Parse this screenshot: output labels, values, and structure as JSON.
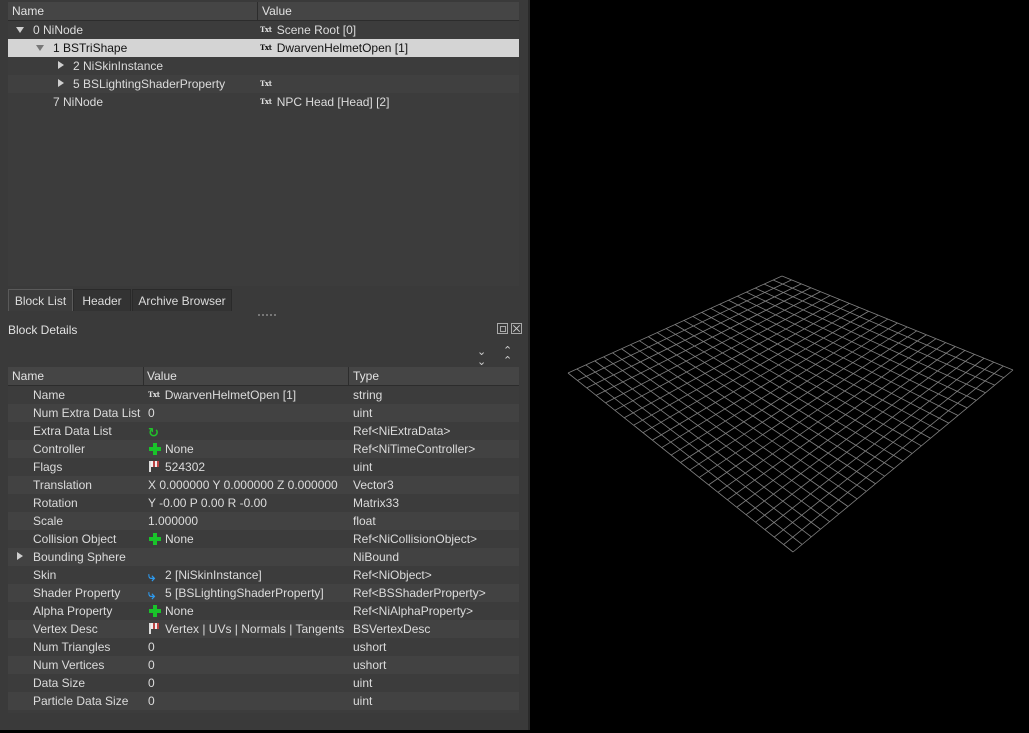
{
  "block_list": {
    "columns": {
      "name": "Name",
      "value": "Value"
    },
    "rows": [
      {
        "name": "0 NiNode",
        "value": "Scene Root [0]"
      },
      {
        "name": "1 BSTriShape",
        "value": "DwarvenHelmetOpen [1]"
      },
      {
        "name": "2 NiSkinInstance",
        "value": ""
      },
      {
        "name": "5 BSLightingShaderProperty",
        "value": ""
      },
      {
        "name": "7 NiNode",
        "value": "NPC Head [Head] [2]"
      }
    ],
    "txt_icon": "Txt"
  },
  "tabs": [
    "Block List",
    "Header",
    "Archive Browser"
  ],
  "block_details": {
    "title": "Block Details",
    "columns": {
      "name": "Name",
      "value": "Value",
      "type": "Type"
    },
    "rows": [
      {
        "name": "Name",
        "value": "DwarvenHelmetOpen [1]",
        "type": "string"
      },
      {
        "name": "Num Extra Data List",
        "value": "0",
        "type": "uint"
      },
      {
        "name": "Extra Data List",
        "value": "",
        "type": "Ref<NiExtraData>"
      },
      {
        "name": "Controller",
        "value": "None",
        "type": "Ref<NiTimeController>"
      },
      {
        "name": "Flags",
        "value": "524302",
        "type": "uint"
      },
      {
        "name": "Translation",
        "value": "X 0.000000 Y 0.000000 Z 0.000000",
        "type": "Vector3"
      },
      {
        "name": "Rotation",
        "value": "Y -0.00 P 0.00 R -0.00",
        "type": "Matrix33"
      },
      {
        "name": "Scale",
        "value": "1.000000",
        "type": "float"
      },
      {
        "name": "Collision Object",
        "value": "None",
        "type": "Ref<NiCollisionObject>"
      },
      {
        "name": "Bounding Sphere",
        "value": "",
        "type": "NiBound"
      },
      {
        "name": "Skin",
        "value": "2 [NiSkinInstance]",
        "type": "Ref<NiObject>"
      },
      {
        "name": "Shader Property",
        "value": "5 [BSLightingShaderProperty]",
        "type": "Ref<BSShaderProperty>"
      },
      {
        "name": "Alpha Property",
        "value": "None",
        "type": "Ref<NiAlphaProperty>"
      },
      {
        "name": "Vertex Desc",
        "value": "Vertex | UVs | Normals | Tangents",
        "type": "BSVertexDesc"
      },
      {
        "name": "Num Triangles",
        "value": "0",
        "type": "ushort"
      },
      {
        "name": "Num Vertices",
        "value": "0",
        "type": "ushort"
      },
      {
        "name": "Data Size",
        "value": "0",
        "type": "uint"
      },
      {
        "name": "Particle Data Size",
        "value": "0",
        "type": "uint"
      }
    ]
  },
  "colors": {
    "panel": "#3a3a3a",
    "selection": "#d4d4d4",
    "grid": "#808080",
    "add_icon": "#19c32a",
    "link_icon": "#2d9bf0"
  }
}
